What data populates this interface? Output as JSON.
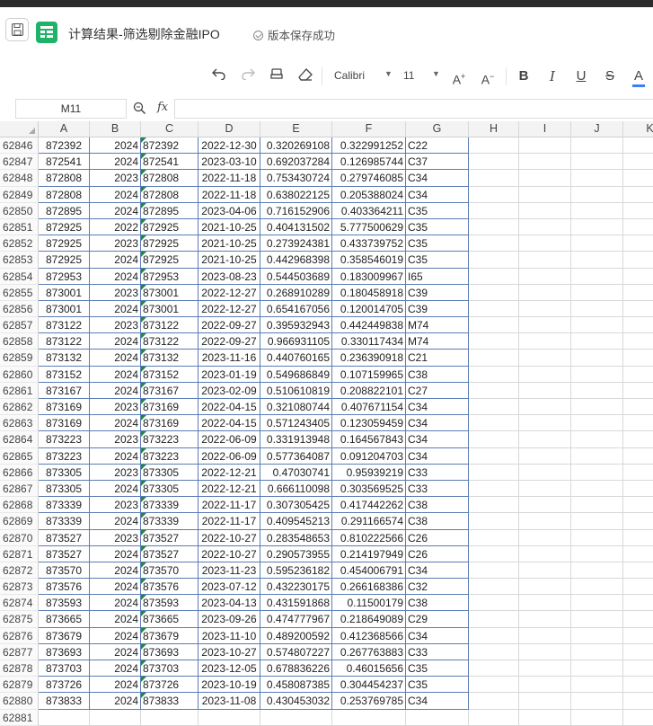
{
  "title_bar": {
    "doc_title": "计算结果-筛选剔除金融IPO",
    "save_status": "版本保存成功"
  },
  "toolbar": {
    "font_name": "Calibri",
    "font_size": "11",
    "font_color": "#3d7ff4"
  },
  "formula_bar": {
    "name_box": "M11",
    "fx_label": "fx",
    "formula": ""
  },
  "columns": [
    "A",
    "B",
    "C",
    "D",
    "E",
    "F",
    "G",
    "H",
    "I",
    "J",
    "K"
  ],
  "rows": [
    {
      "num": "62846",
      "a": "872392",
      "b": "2024",
      "c": "872392",
      "d": "2022-12-30",
      "e": "0.320269108",
      "f": "0.322991252",
      "g": "C22"
    },
    {
      "num": "62847",
      "a": "872541",
      "b": "2024",
      "c": "872541",
      "d": "2023-03-10",
      "e": "0.692037284",
      "f": "0.126985744",
      "g": "C37"
    },
    {
      "num": "62848",
      "a": "872808",
      "b": "2023",
      "c": "872808",
      "d": "2022-11-18",
      "e": "0.753430724",
      "f": "0.279746085",
      "g": "C34"
    },
    {
      "num": "62849",
      "a": "872808",
      "b": "2024",
      "c": "872808",
      "d": "2022-11-18",
      "e": "0.638022125",
      "f": "0.205388024",
      "g": "C34"
    },
    {
      "num": "62850",
      "a": "872895",
      "b": "2024",
      "c": "872895",
      "d": "2023-04-06",
      "e": "0.716152906",
      "f": "0.403364211",
      "g": "C35"
    },
    {
      "num": "62851",
      "a": "872925",
      "b": "2022",
      "c": "872925",
      "d": "2021-10-25",
      "e": "0.404131502",
      "f": "5.777500629",
      "g": "C35"
    },
    {
      "num": "62852",
      "a": "872925",
      "b": "2023",
      "c": "872925",
      "d": "2021-10-25",
      "e": "0.273924381",
      "f": "0.433739752",
      "g": "C35"
    },
    {
      "num": "62853",
      "a": "872925",
      "b": "2024",
      "c": "872925",
      "d": "2021-10-25",
      "e": "0.442968398",
      "f": "0.358546019",
      "g": "C35"
    },
    {
      "num": "62854",
      "a": "872953",
      "b": "2024",
      "c": "872953",
      "d": "2023-08-23",
      "e": "0.544503689",
      "f": "0.183009967",
      "g": "I65"
    },
    {
      "num": "62855",
      "a": "873001",
      "b": "2023",
      "c": "873001",
      "d": "2022-12-27",
      "e": "0.268910289",
      "f": "0.180458918",
      "g": "C39"
    },
    {
      "num": "62856",
      "a": "873001",
      "b": "2024",
      "c": "873001",
      "d": "2022-12-27",
      "e": "0.654167056",
      "f": "0.120014705",
      "g": "C39"
    },
    {
      "num": "62857",
      "a": "873122",
      "b": "2023",
      "c": "873122",
      "d": "2022-09-27",
      "e": "0.395932943",
      "f": "0.442449838",
      "g": "M74"
    },
    {
      "num": "62858",
      "a": "873122",
      "b": "2024",
      "c": "873122",
      "d": "2022-09-27",
      "e": "0.966931105",
      "f": "0.330117434",
      "g": "M74"
    },
    {
      "num": "62859",
      "a": "873132",
      "b": "2024",
      "c": "873132",
      "d": "2023-11-16",
      "e": "0.440760165",
      "f": "0.236390918",
      "g": "C21"
    },
    {
      "num": "62860",
      "a": "873152",
      "b": "2024",
      "c": "873152",
      "d": "2023-01-19",
      "e": "0.549686849",
      "f": "0.107159965",
      "g": "C38"
    },
    {
      "num": "62861",
      "a": "873167",
      "b": "2024",
      "c": "873167",
      "d": "2023-02-09",
      "e": "0.510610819",
      "f": "0.208822101",
      "g": "C27"
    },
    {
      "num": "62862",
      "a": "873169",
      "b": "2023",
      "c": "873169",
      "d": "2022-04-15",
      "e": "0.321080744",
      "f": "0.407671154",
      "g": "C34"
    },
    {
      "num": "62863",
      "a": "873169",
      "b": "2024",
      "c": "873169",
      "d": "2022-04-15",
      "e": "0.571243405",
      "f": "0.123059459",
      "g": "C34"
    },
    {
      "num": "62864",
      "a": "873223",
      "b": "2023",
      "c": "873223",
      "d": "2022-06-09",
      "e": "0.331913948",
      "f": "0.164567843",
      "g": "C34"
    },
    {
      "num": "62865",
      "a": "873223",
      "b": "2024",
      "c": "873223",
      "d": "2022-06-09",
      "e": "0.577364087",
      "f": "0.091204703",
      "g": "C34"
    },
    {
      "num": "62866",
      "a": "873305",
      "b": "2023",
      "c": "873305",
      "d": "2022-12-21",
      "e": "0.47030741",
      "f": "0.95939219",
      "g": "C33"
    },
    {
      "num": "62867",
      "a": "873305",
      "b": "2024",
      "c": "873305",
      "d": "2022-12-21",
      "e": "0.666110098",
      "f": "0.303569525",
      "g": "C33"
    },
    {
      "num": "62868",
      "a": "873339",
      "b": "2023",
      "c": "873339",
      "d": "2022-11-17",
      "e": "0.307305425",
      "f": "0.417442262",
      "g": "C38"
    },
    {
      "num": "62869",
      "a": "873339",
      "b": "2024",
      "c": "873339",
      "d": "2022-11-17",
      "e": "0.409545213",
      "f": "0.291166574",
      "g": "C38"
    },
    {
      "num": "62870",
      "a": "873527",
      "b": "2023",
      "c": "873527",
      "d": "2022-10-27",
      "e": "0.283548653",
      "f": "0.810222566",
      "g": "C26"
    },
    {
      "num": "62871",
      "a": "873527",
      "b": "2024",
      "c": "873527",
      "d": "2022-10-27",
      "e": "0.290573955",
      "f": "0.214197949",
      "g": "C26"
    },
    {
      "num": "62872",
      "a": "873570",
      "b": "2024",
      "c": "873570",
      "d": "2023-11-23",
      "e": "0.595236182",
      "f": "0.454006791",
      "g": "C34"
    },
    {
      "num": "62873",
      "a": "873576",
      "b": "2024",
      "c": "873576",
      "d": "2023-07-12",
      "e": "0.432230175",
      "f": "0.266168386",
      "g": "C32"
    },
    {
      "num": "62874",
      "a": "873593",
      "b": "2024",
      "c": "873593",
      "d": "2023-04-13",
      "e": "0.431591868",
      "f": "0.11500179",
      "g": "C38"
    },
    {
      "num": "62875",
      "a": "873665",
      "b": "2024",
      "c": "873665",
      "d": "2023-09-26",
      "e": "0.474777967",
      "f": "0.218649089",
      "g": "C29"
    },
    {
      "num": "62876",
      "a": "873679",
      "b": "2024",
      "c": "873679",
      "d": "2023-11-10",
      "e": "0.489200592",
      "f": "0.412368566",
      "g": "C34"
    },
    {
      "num": "62877",
      "a": "873693",
      "b": "2024",
      "c": "873693",
      "d": "2023-10-27",
      "e": "0.574807227",
      "f": "0.267763883",
      "g": "C33"
    },
    {
      "num": "62878",
      "a": "873703",
      "b": "2024",
      "c": "873703",
      "d": "2023-12-05",
      "e": "0.678836226",
      "f": "0.46015656",
      "g": "C35"
    },
    {
      "num": "62879",
      "a": "873726",
      "b": "2024",
      "c": "873726",
      "d": "2023-10-19",
      "e": "0.458087385",
      "f": "0.304454237",
      "g": "C35"
    },
    {
      "num": "62880",
      "a": "873833",
      "b": "2024",
      "c": "873833",
      "d": "2023-11-08",
      "e": "0.430453032",
      "f": "0.253769785",
      "g": "C34"
    },
    {
      "num": "62881",
      "a": "",
      "b": "",
      "c": "",
      "d": "",
      "e": "",
      "f": "",
      "g": ""
    }
  ]
}
